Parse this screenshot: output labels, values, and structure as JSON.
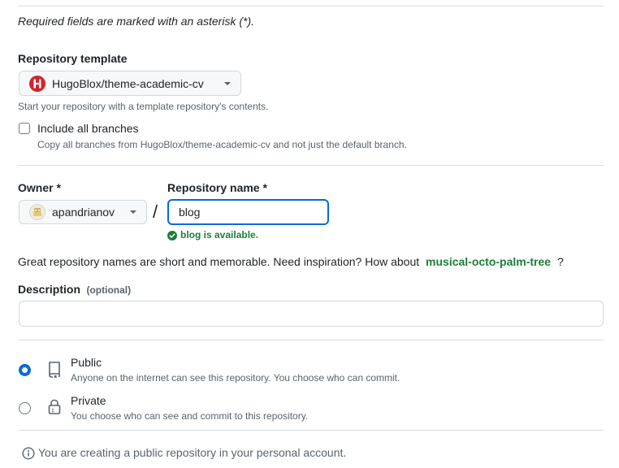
{
  "required_note": "Required fields are marked with an asterisk (*).",
  "template": {
    "label": "Repository template",
    "selected": "HugoBlox/theme-academic-cv",
    "note": "Start your repository with a template repository's contents."
  },
  "branches": {
    "label": "Include all branches",
    "note": "Copy all branches from HugoBlox/theme-academic-cv and not just the default branch."
  },
  "owner": {
    "label": "Owner *",
    "selected": "apandrianov"
  },
  "separator": "/",
  "repo_name": {
    "label": "Repository name *",
    "value": "blog",
    "available_text": "blog is available."
  },
  "inspiration": {
    "prefix": "Great repository names are short and memorable. Need inspiration? How about",
    "suggestion": "musical-octo-palm-tree",
    "suffix": "?"
  },
  "description": {
    "label": "Description",
    "optional": "(optional)",
    "value": "",
    "placeholder": ""
  },
  "visibility": {
    "public": {
      "label": "Public",
      "desc": "Anyone on the internet can see this repository. You choose who can commit.",
      "selected": true
    },
    "private": {
      "label": "Private",
      "desc": "You choose who can see and commit to this repository.",
      "selected": false
    }
  },
  "info_text": "You are creating a public repository in your personal account.",
  "colors": {
    "accent_blue": "#0969da",
    "success_green": "#1a7f37",
    "template_icon_red": "#d1242f",
    "border": "#d1d9e0"
  },
  "icons": {
    "template": "hugoblox-logo-icon",
    "owner": "user-avatar-icon",
    "check": "check-circle-fill-icon",
    "public": "repo-icon",
    "private": "lock-icon",
    "info": "info-icon"
  }
}
